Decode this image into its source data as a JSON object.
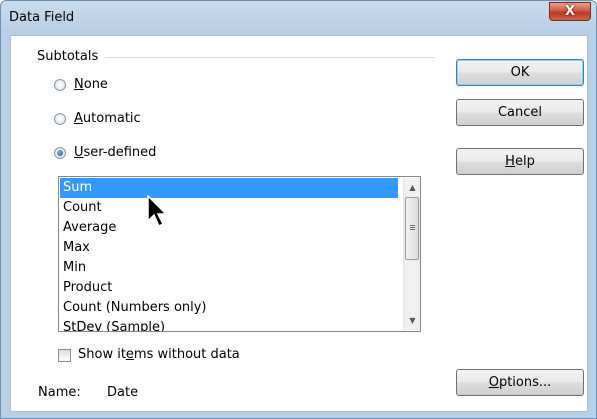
{
  "window": {
    "title": "Data Field",
    "close_label": "X"
  },
  "subtotals": {
    "label": "Subtotals",
    "options": [
      {
        "label_pre": "",
        "label_mnemonic": "N",
        "label_post": "one",
        "selected": false
      },
      {
        "label_pre": "",
        "label_mnemonic": "A",
        "label_post": "utomatic",
        "selected": false
      },
      {
        "label_pre": "",
        "label_mnemonic": "U",
        "label_post": "ser-defined",
        "selected": true
      }
    ]
  },
  "functions": {
    "items": [
      "Sum",
      "Count",
      "Average",
      "Max",
      "Min",
      "Product",
      "Count (Numbers only)",
      "StDev (Sample)"
    ],
    "selected": "Sum"
  },
  "show_items": {
    "label_pre": "Show it",
    "label_mnemonic": "e",
    "label_post": "ms without data",
    "checked": false
  },
  "name": {
    "label": "Name:",
    "value": "Date"
  },
  "buttons": {
    "ok": "OK",
    "cancel": "Cancel",
    "help_mnemonic": "H",
    "help_post": "elp",
    "options_mnemonic": "O",
    "options_post": "ptions..."
  }
}
